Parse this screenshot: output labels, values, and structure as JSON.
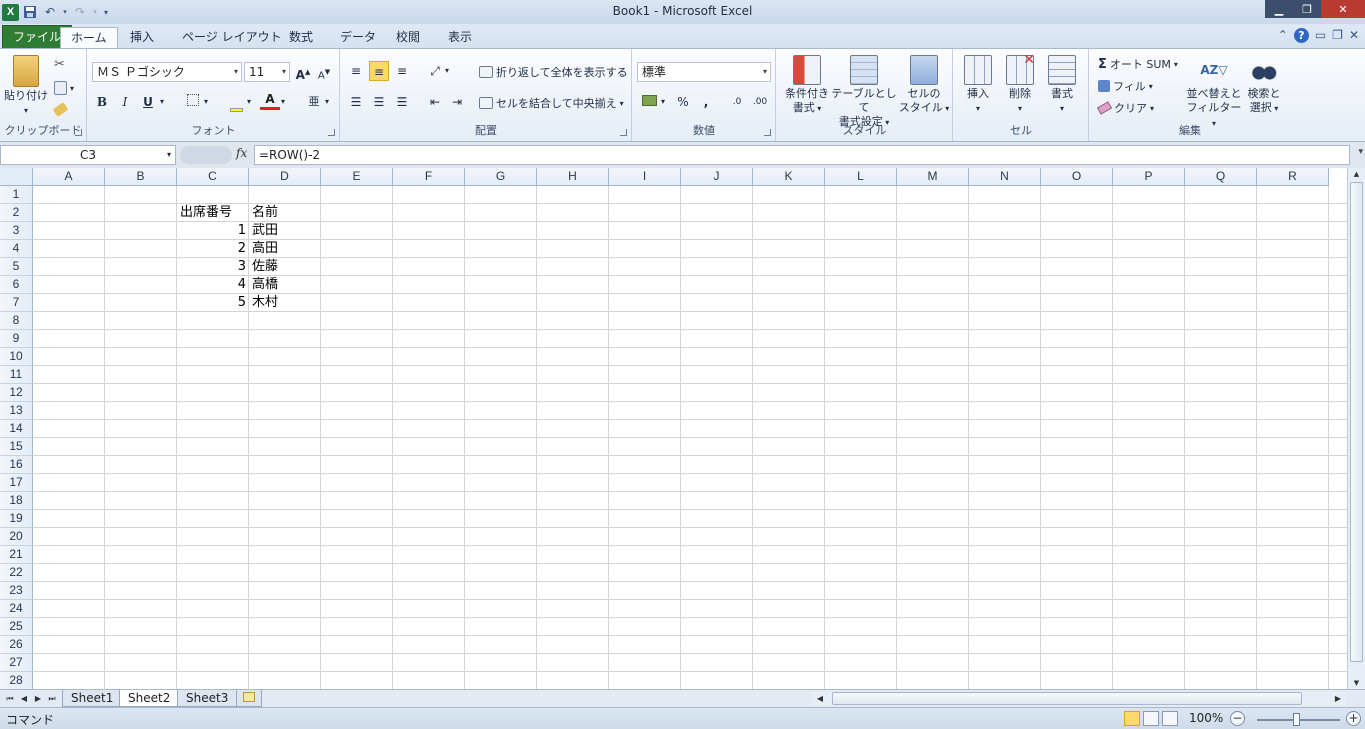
{
  "window": {
    "title": "Book1  -  Microsoft Excel"
  },
  "tabs": [
    "ファイル",
    "ホーム",
    "挿入",
    "ページ レイアウト",
    "数式",
    "データ",
    "校閲",
    "表示"
  ],
  "ribbon": {
    "clipboard": {
      "paste": "貼り付け",
      "label": "クリップボード"
    },
    "font": {
      "name": "ＭＳ Ｐゴシック",
      "size": "11",
      "label": "フォント",
      "bold": "B",
      "italic": "I",
      "underline": "U"
    },
    "alignment": {
      "wrap": "折り返して全体を表示する",
      "merge": "セルを結合して中央揃え",
      "label": "配置"
    },
    "number": {
      "format": "標準",
      "label": "数値",
      "percent": "%",
      "comma": ","
    },
    "styles": {
      "conditional": [
        "条件付き",
        "書式"
      ],
      "table": [
        "テーブルとして",
        "書式設定"
      ],
      "cell": [
        "セルの",
        "スタイル"
      ],
      "label": "スタイル"
    },
    "cells": {
      "insert": "挿入",
      "delete": "削除",
      "format": "書式",
      "label": "セル"
    },
    "editing": {
      "autosum": "オート SUM",
      "fill": "フィル",
      "clear": "クリア",
      "sort": [
        "並べ替えと",
        "フィルター"
      ],
      "find": [
        "検索と",
        "選択"
      ],
      "label": "編集"
    }
  },
  "formula_bar": {
    "name_box": "C3",
    "fx": "fx",
    "formula": "=ROW()-2"
  },
  "columns": [
    "A",
    "B",
    "C",
    "D",
    "E",
    "F",
    "G",
    "H",
    "I",
    "J",
    "K",
    "L",
    "M",
    "N",
    "O",
    "P",
    "Q",
    "R"
  ],
  "rows": [
    "1",
    "2",
    "3",
    "4",
    "5",
    "6",
    "7",
    "8",
    "9",
    "10",
    "11",
    "12",
    "13",
    "14",
    "15",
    "16",
    "17",
    "18",
    "19",
    "20",
    "21",
    "22",
    "23",
    "24",
    "25",
    "26",
    "27",
    "28"
  ],
  "cells": {
    "C2": "出席番号",
    "D2": "名前",
    "C3": "1",
    "D3": "武田",
    "C4": "2",
    "D4": "高田",
    "C5": "3",
    "D5": "佐藤",
    "C6": "4",
    "D6": "高橋",
    "C7": "5",
    "D7": "木村"
  },
  "sheets": [
    "Sheet1",
    "Sheet2",
    "Sheet3"
  ],
  "active_sheet": "Sheet2",
  "status": {
    "mode": "コマンド",
    "zoom": "100%"
  }
}
